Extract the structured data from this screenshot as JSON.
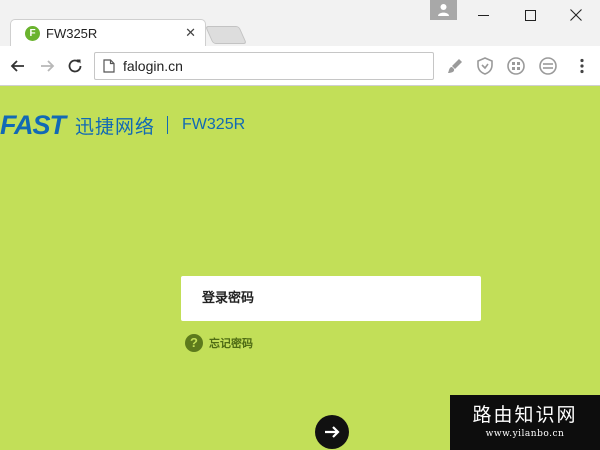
{
  "browser": {
    "tab": {
      "title": "FW325R",
      "favicon_letter": "F",
      "close_glyph": "✕"
    },
    "address_bar": {
      "url": "falogin.cn"
    },
    "icons": {
      "back": "arrow-left-icon",
      "forward": "arrow-right-icon",
      "reload": "reload-icon",
      "page_info": "page-icon",
      "profile": "person-icon",
      "minimize": "minimize-icon",
      "maximize": "maximize-icon",
      "close": "close-icon",
      "extensions": [
        "brush-extension-icon",
        "shield-extension-icon",
        "grid-extension-icon",
        "grid-extension-icon-2"
      ],
      "menu": "more-vertical-icon"
    }
  },
  "header": {
    "logo": "FAST",
    "brand_cn": "迅捷网络",
    "model": "FW325R"
  },
  "login": {
    "password_placeholder": "登录密码",
    "forgot_label": "忘记密码",
    "forgot_icon_glyph": "?",
    "submit_icon": "arrow-right-circle-icon"
  },
  "watermark": {
    "title": "路由知识网",
    "url": "www.yilanbo.cn"
  },
  "colors": {
    "page_background": "#c2df58",
    "brand_blue": "#1169b5",
    "forgot_green": "#4f6c14",
    "submit_button": "#111111"
  }
}
